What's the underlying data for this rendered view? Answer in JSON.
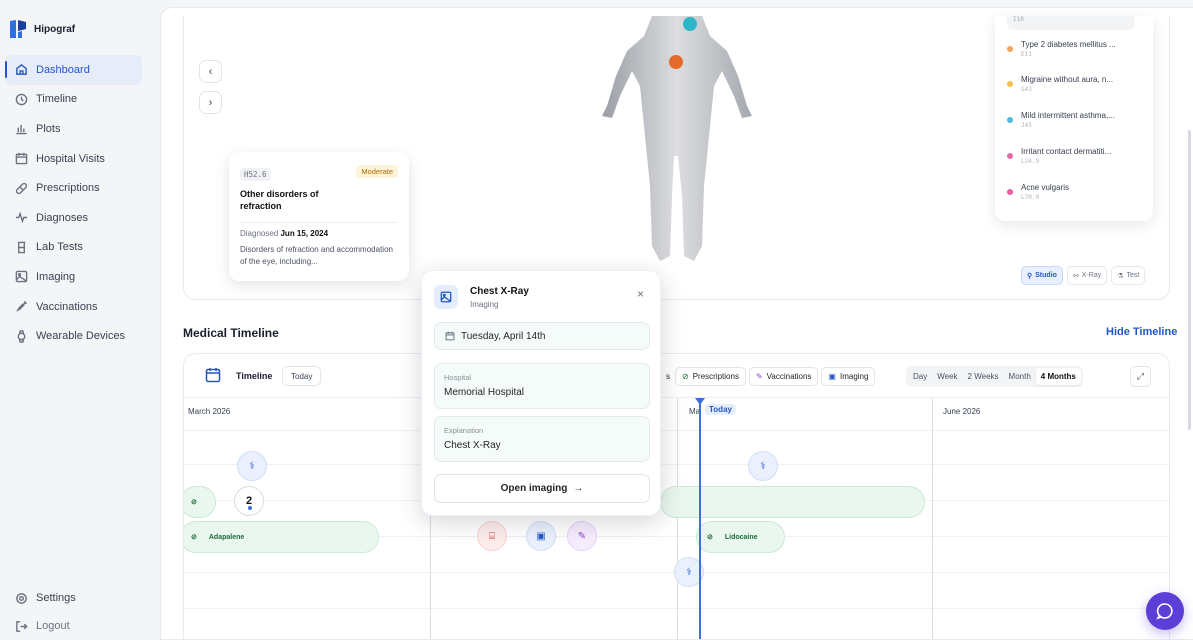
{
  "brand": {
    "name": "Hipograf"
  },
  "nav": {
    "items": [
      {
        "label": "Dashboard",
        "icon": "home-icon",
        "active": true
      },
      {
        "label": "Timeline",
        "icon": "clock-icon"
      },
      {
        "label": "Plots",
        "icon": "bar-chart-icon"
      },
      {
        "label": "Hospital Visits",
        "icon": "calendar-icon"
      },
      {
        "label": "Prescriptions",
        "icon": "pill-icon"
      },
      {
        "label": "Diagnoses",
        "icon": "activity-icon"
      },
      {
        "label": "Lab Tests",
        "icon": "test-tube-icon"
      },
      {
        "label": "Imaging",
        "icon": "image-icon"
      },
      {
        "label": "Vaccinations",
        "icon": "syringe-icon"
      },
      {
        "label": "Wearable Devices",
        "icon": "watch-icon"
      }
    ],
    "settings": "Settings",
    "logout": "Logout"
  },
  "diagnosis_card": {
    "code": "H52.6",
    "severity": "Moderate",
    "title": "Other disorders of refraction",
    "diagnosed_label": "Diagnosed",
    "diagnosed_date": "Jun 15, 2024",
    "description": "Disorders of refraction and accommodation of the eye, including..."
  },
  "conditions": {
    "top_code": "I10",
    "items": [
      {
        "name": "Type 2 diabetes mellitus ...",
        "code": "E11",
        "color": "#f4a25c"
      },
      {
        "name": "Migraine without aura, n...",
        "code": "G43",
        "color": "#f6c14a"
      },
      {
        "name": "Mild intermittent asthma,...",
        "code": "J45",
        "color": "#4fb9d8"
      },
      {
        "name": "Irritant contact dermatiti...",
        "code": "L24.9",
        "color": "#e96aa6"
      },
      {
        "name": "Acne vulgaris",
        "code": "L70.0",
        "color": "#ea5fa0"
      }
    ]
  },
  "view_toggle": {
    "studio": "Studio",
    "xray": "X-Ray",
    "test": "Test"
  },
  "medical_timeline": {
    "title": "Medical Timeline",
    "hide_label": "Hide Timeline",
    "toolbar_label": "Timeline",
    "today_button": "Today",
    "filters": [
      {
        "label": "s",
        "icon": ""
      },
      {
        "label": "Prescriptions",
        "icon": "pill-icon"
      },
      {
        "label": "Vaccinations",
        "icon": "syringe-icon"
      },
      {
        "label": "Imaging",
        "icon": "image-icon"
      }
    ],
    "ranges": [
      "Day",
      "Week",
      "2 Weeks",
      "Month",
      "4 Months"
    ],
    "active_range": "4 Months",
    "months": [
      "March 2026",
      "Ma",
      "June 2026"
    ],
    "today_marker": "Today",
    "events": {
      "adapalene": "Adapalene",
      "lidocaine": "Lidocaine",
      "cluster_count": "2"
    }
  },
  "popup": {
    "title": "Chest X-Ray",
    "subtitle": "Imaging",
    "date": "Tuesday, April 14th",
    "hospital_label": "Hospital",
    "hospital_value": "Memorial Hospital",
    "explanation_label": "Explanation",
    "explanation_value": "Chest X-Ray",
    "open_button": "Open imaging",
    "open_arrow": "→",
    "close_glyph": "×"
  },
  "colors": {
    "accent": "#2457c5",
    "today_line": "#3b6fdc",
    "chat": "#5b3fd6"
  }
}
